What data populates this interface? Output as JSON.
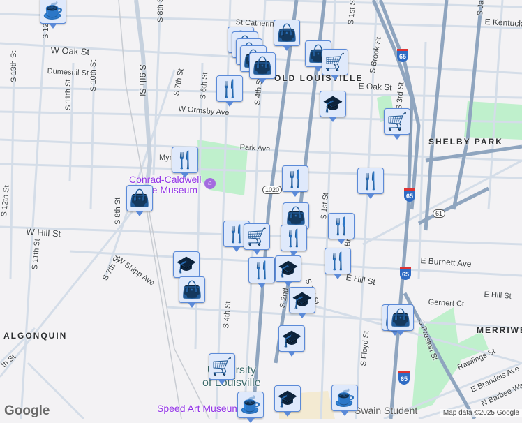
{
  "streets": {
    "w_oak": "W Oak St",
    "st_catherine": "St Catherin",
    "e_kentucky": "E Kentuck",
    "dumesnil": "Dumesnil St",
    "s13": "S 13th St",
    "s12_top": "S 12",
    "s11": "S 11th St",
    "s10": "S 10th St",
    "s9": "S 9th St",
    "s8": "S 8th St",
    "s7": "S 7th St",
    "s6": "S 6th St",
    "s4": "S 4th St",
    "s4_low": "S 4th St",
    "w_ormsby": "W Ormsby Ave",
    "park": "Park Ave",
    "myrtle": "Myr",
    "s1": "S 1st St",
    "s1_mid": "S 1st St",
    "s1_low": "S 1st St",
    "brook": "S Brook St",
    "e_oak": "E Oak St",
    "s_jackson": "S Ja",
    "s_shelby": "S",
    "w_hill": "W Hill St",
    "s12": "S 12th St",
    "s11_low": "S 11th St",
    "s8_low": "S 8th St",
    "s7_low": "S 7th St",
    "w_shipp": "W Shipp Ave",
    "s2": "S 2nd",
    "e_burnett": "E Burnett Ave",
    "e_hill": "E Hill St",
    "e_hill2": "E Hill St",
    "gernert": "Gernert Ct",
    "s_floyd": "S Floyd St",
    "s_preston": "S Preston St",
    "rawlings": "Rawlings St",
    "e_brandeis": "E Brandeis Ave",
    "n_barbee": "N Barbee Way",
    "brook_low": "Br",
    "s_3rd": "S 3rd St",
    "sw_8": "th St"
  },
  "neighborhoods": {
    "old_louisville": "OLD LOUISVILLE",
    "shelby_park": "SHELBY PARK",
    "algonquin": "ALGONQUIN",
    "merriwether": "MERRIWE"
  },
  "places": {
    "conrad": "Conrad-Caldwell",
    "conrad2": "House Museum",
    "university": "University",
    "university2": "of Louisville",
    "speed": "Speed Art Museum",
    "swain": "Swain Student"
  },
  "shields": {
    "i65": "65",
    "ky1020": "1020",
    "ky61": "61"
  },
  "attribution": {
    "logo": "Google",
    "copyright": "Map data ©2025 Google"
  },
  "markers": [
    "cafe",
    "shopping",
    "shopping",
    "shopping",
    "shopping",
    "shopping",
    "shopping",
    "shopping",
    "grocery",
    "restaurant",
    "school",
    "grocery",
    "restaurant",
    "restaurant",
    "restaurant",
    "shopping",
    "shopping",
    "restaurant",
    "restaurant",
    "grocery",
    "restaurant",
    "school",
    "restaurant",
    "restaurant",
    "school",
    "shopping",
    "school",
    "school",
    "shopping",
    "shopping",
    "grocery",
    "cafe",
    "school",
    "cafe"
  ],
  "colors": {
    "bg": "#f3f2f4",
    "road": "#d4dde8",
    "arterial": "#8fa5bf",
    "park": "#bff0cc",
    "marker_fill": "#dfe9fb",
    "marker_icon": "#0d3d62"
  }
}
